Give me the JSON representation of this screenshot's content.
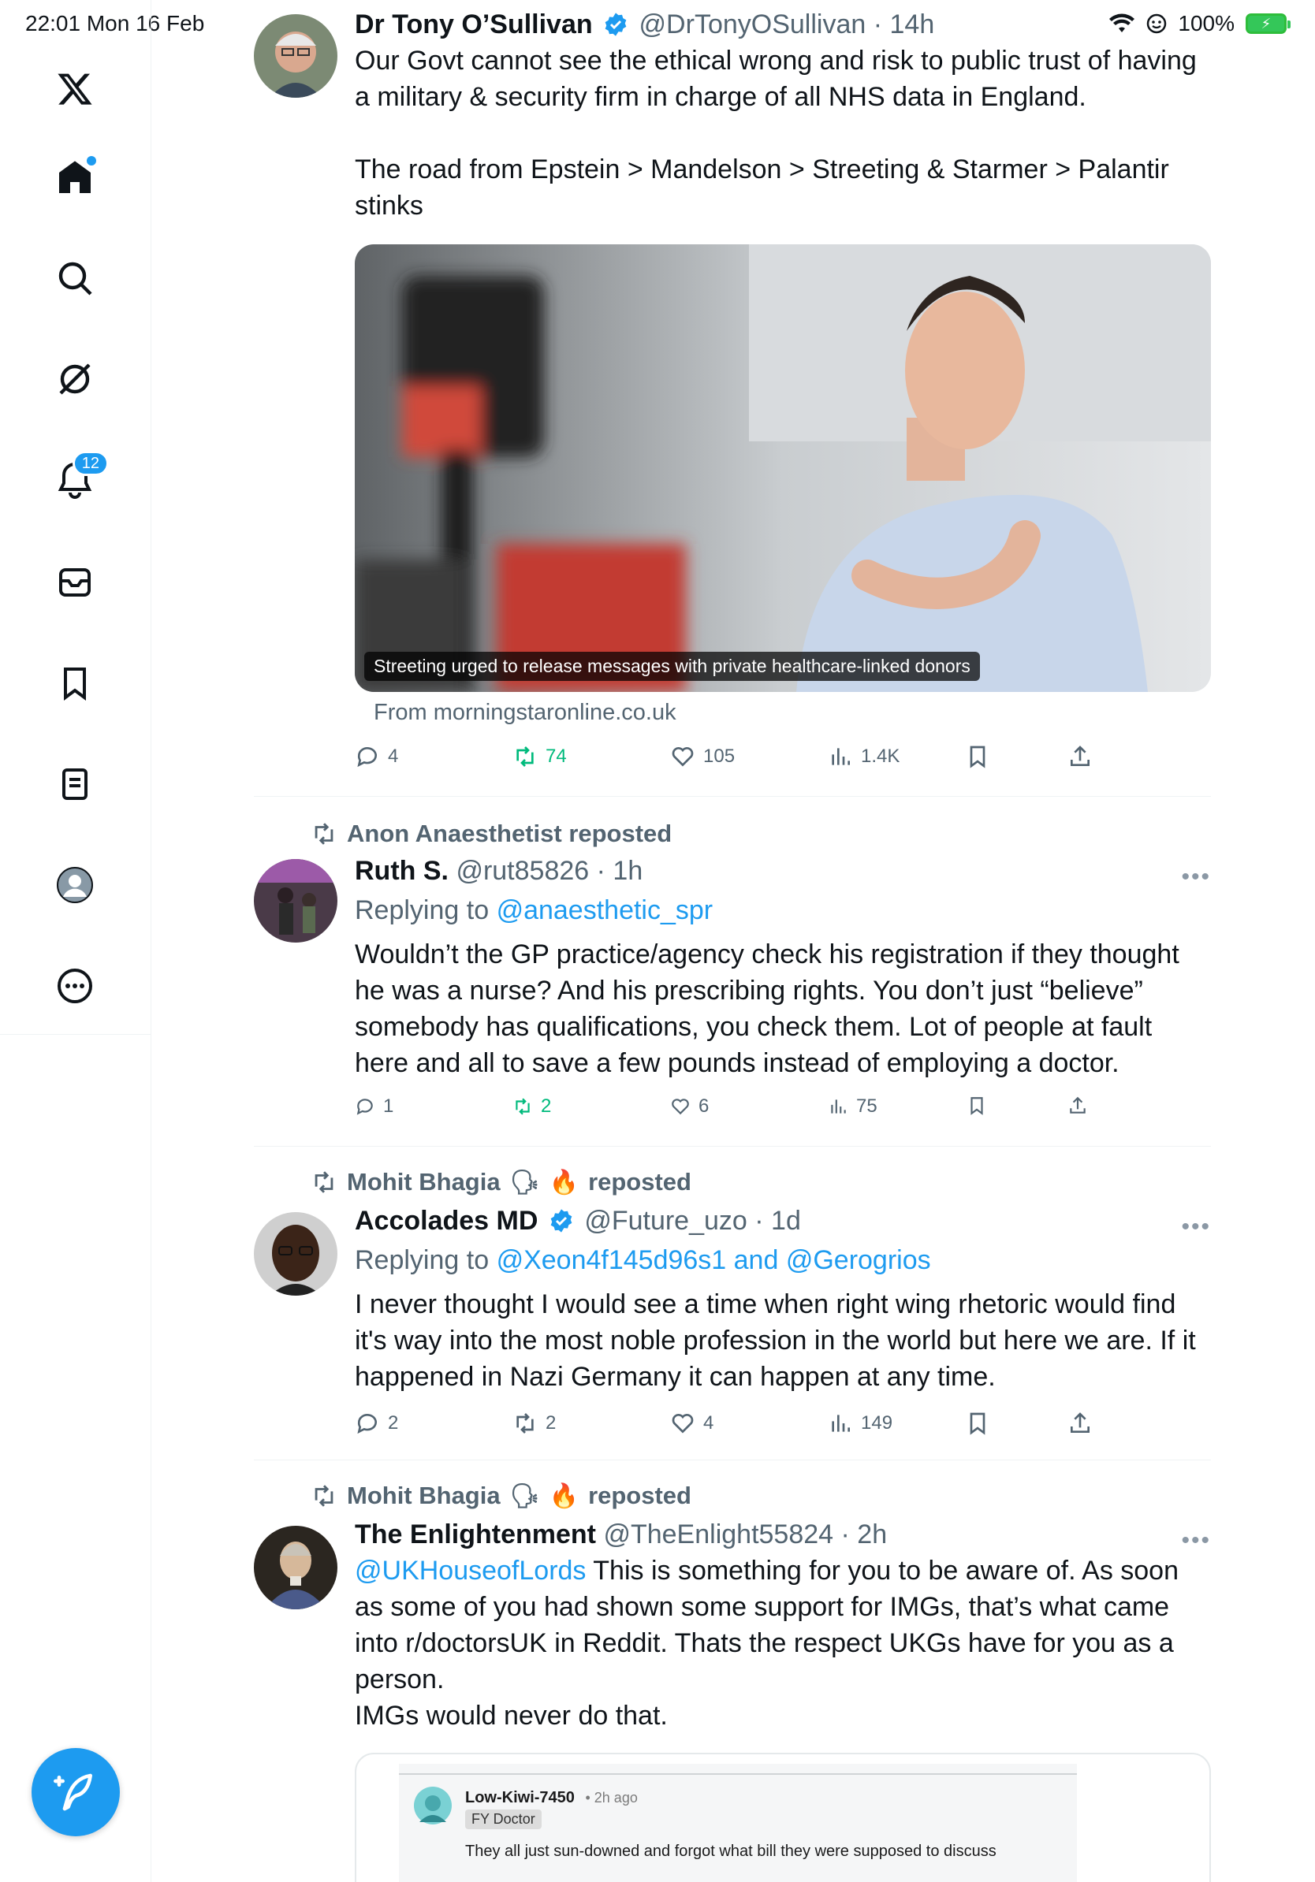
{
  "status": {
    "time_date": "22:01  Mon 16 Feb",
    "battery_pct": "100%"
  },
  "sidebar": {
    "notifications_badge": "12",
    "items": [
      "x-logo",
      "home",
      "explore",
      "grok",
      "notifications",
      "messages",
      "bookmarks",
      "lists",
      "profile",
      "more"
    ]
  },
  "tweets": [
    {
      "name": "Dr Tony O’Sullivan",
      "handle": "@DrTonyOSullivan",
      "time": "14h",
      "text1": "Our Govt cannot see the ethical wrong and risk to public trust of having a military & security firm in charge of all NHS data in England.",
      "text2": "The road from Epstein > Mandelson > Streeting & Starmer > Palantir stinks",
      "card_caption": "Streeting urged to release messages with private healthcare-linked donors",
      "card_source": "From morningstaronline.co.uk",
      "replies": "4",
      "reposts": "74",
      "likes": "105",
      "views": "1.4K"
    },
    {
      "reposted_by": "Anon Anaesthetist reposted",
      "name": "Ruth S.",
      "handle": "@rut85826",
      "time": "1h",
      "replying_label": "Replying to",
      "replying_to": "@anaesthetic_spr",
      "text": "Wouldn’t the GP practice/agency check his registration if they thought he was a nurse? And his prescribing rights. You don’t just “believe” somebody has qualifications, you check them. Lot of people at fault here and all to save a few pounds instead of employing a doctor.",
      "replies": "1",
      "reposts": "2",
      "likes": "6",
      "views": "75"
    },
    {
      "reposted_by_name": "Mohit Bhagia",
      "reposted_suffix": "reposted",
      "name": "Accolades MD",
      "handle": "@Future_uzo",
      "time": "1d",
      "replying_label": "Replying to",
      "replying_to": "@Xeon4f145d96s1 and @Gerogrios",
      "text": "I never thought I would see a time when right wing rhetoric would find it's way into the most noble profession in the world but here we are. If it happened in Nazi Germany it can happen at any time.",
      "replies": "2",
      "reposts": "2",
      "likes": "4",
      "views": "149"
    },
    {
      "reposted_by_name": "Mohit Bhagia",
      "reposted_suffix": "reposted",
      "name": "The Enlightenment",
      "handle": "@TheEnlight55824",
      "time": "2h",
      "mention": "@UKHouseofLords",
      "text": " This is something for you to be aware of. As soon as some of you had shown some support for IMGs, that’s what came into r/doctorsUK in Reddit. Thats the respect UKGs have for you as a person.",
      "text2": "IMGs would never do that.",
      "embed": {
        "user": "Low-Kiwi-7450",
        "time": "• 2h ago",
        "flair": "FY Doctor",
        "comment": "They all just sun-downed and forgot what bill they were supposed to discuss"
      }
    }
  ],
  "colors": {
    "accent": "#1d9bf0",
    "text": "#0f1419",
    "muted": "#536471",
    "repost_green": "#00ba7c"
  }
}
